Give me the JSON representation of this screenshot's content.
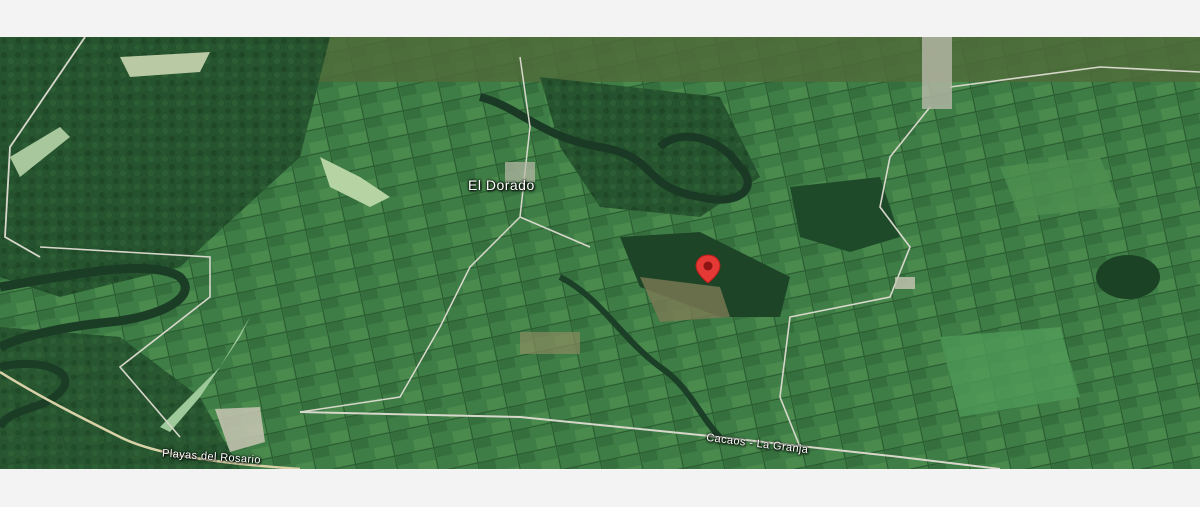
{
  "map": {
    "type": "satellite",
    "colors": {
      "forest": "#1f4a2a",
      "field": "#3f7f47",
      "light_field": "#5b9457",
      "river": "#1a3c27",
      "road": "#d9d9c9",
      "clearing": "#a9c9a0",
      "pin": "#e53935"
    },
    "labels": {
      "place": "El Dorado",
      "road_1": "Playas del Rosario",
      "road_2": "Cacaos - La Granja"
    },
    "marker_icon": "location-pin-icon"
  }
}
